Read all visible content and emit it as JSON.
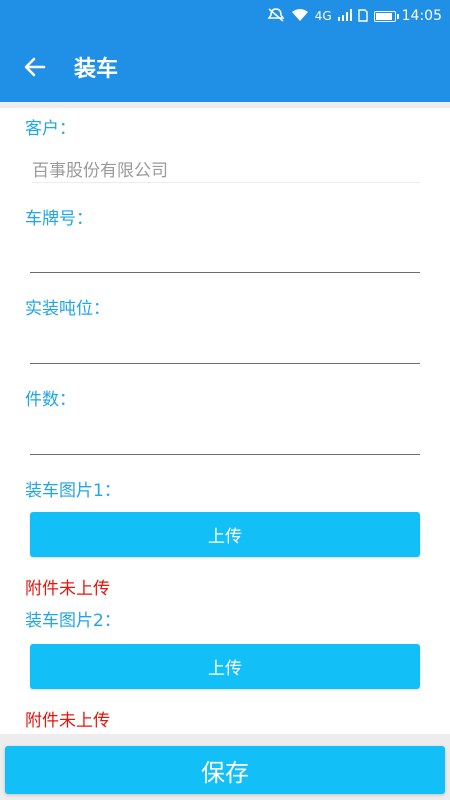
{
  "status_bar": {
    "network": "4G",
    "time": "14:05"
  },
  "app_bar": {
    "title": "装车"
  },
  "form": {
    "customer_label": "客户：",
    "customer_value": "百事股份有限公司",
    "plate_label": "车牌号：",
    "plate_value": "",
    "tonnage_label": "实装吨位：",
    "tonnage_value": "",
    "count_label": "件数：",
    "count_value": "",
    "photo1_label": "装车图片1：",
    "photo1_button": "上传",
    "photo1_status": "附件未上传",
    "photo2_label": "装车图片2：",
    "photo2_button": "上传",
    "photo2_status": "附件未上传"
  },
  "footer": {
    "save_label": "保存"
  },
  "colors": {
    "primary": "#1f90e6",
    "accent": "#12bff7",
    "label": "#1fa6e8",
    "warning": "#e8140c"
  }
}
